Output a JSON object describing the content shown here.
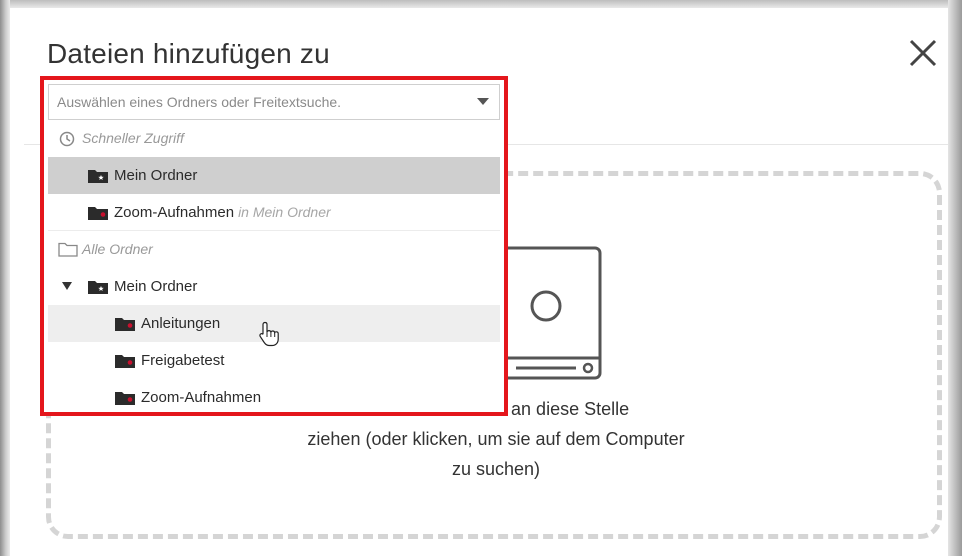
{
  "dialog": {
    "title": "Dateien hinzufügen zu",
    "dropzone_text": [
      "eien an diese Stelle",
      "ziehen (oder klicken, um sie auf dem Computer",
      "zu suchen)"
    ]
  },
  "folder_picker": {
    "placeholder": "Auswählen eines Ordners oder Freitextsuche.",
    "quick_access": {
      "heading": "Schneller Zugriff",
      "items": [
        {
          "label": "Mein Ordner",
          "hint": ""
        },
        {
          "label": "Zoom-Aufnahmen",
          "hint": "in Mein Ordner"
        }
      ]
    },
    "all_folders": {
      "heading": "Alle Ordner",
      "root": "Mein Ordner",
      "children": [
        "Anleitungen",
        "Freigabetest",
        "Zoom-Aufnahmen"
      ]
    },
    "selected_item": "Mein Ordner",
    "hovered_item": "Anleitungen"
  },
  "colors": {
    "highlight_frame": "#e4161c",
    "folder_icon": "#2b2b2b",
    "folder_dot": "#c8102e",
    "selected_row": "#cfcfcf",
    "hover_row": "#eeeeee"
  },
  "icons": {
    "close": "close-icon",
    "clock": "clock-icon",
    "folder_outline": "folder-outline-icon",
    "folder_star": "folder-star-icon",
    "folder_shared": "folder-icon",
    "expand": "triangle-down-icon",
    "dropdown": "chevron-down-icon",
    "cursor": "hand-pointer-icon",
    "monitor": "monitor-icon"
  }
}
